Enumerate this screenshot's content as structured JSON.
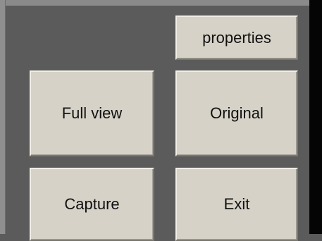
{
  "panel": {
    "buttons": {
      "properties": "properties",
      "full_view": "Full view",
      "original": "Original",
      "capture": "Capture",
      "exit": "Exit"
    }
  },
  "colors": {
    "panel_background": "#5b5b5b",
    "button_face": "#d6d2c8",
    "right_edge": "#050505"
  }
}
